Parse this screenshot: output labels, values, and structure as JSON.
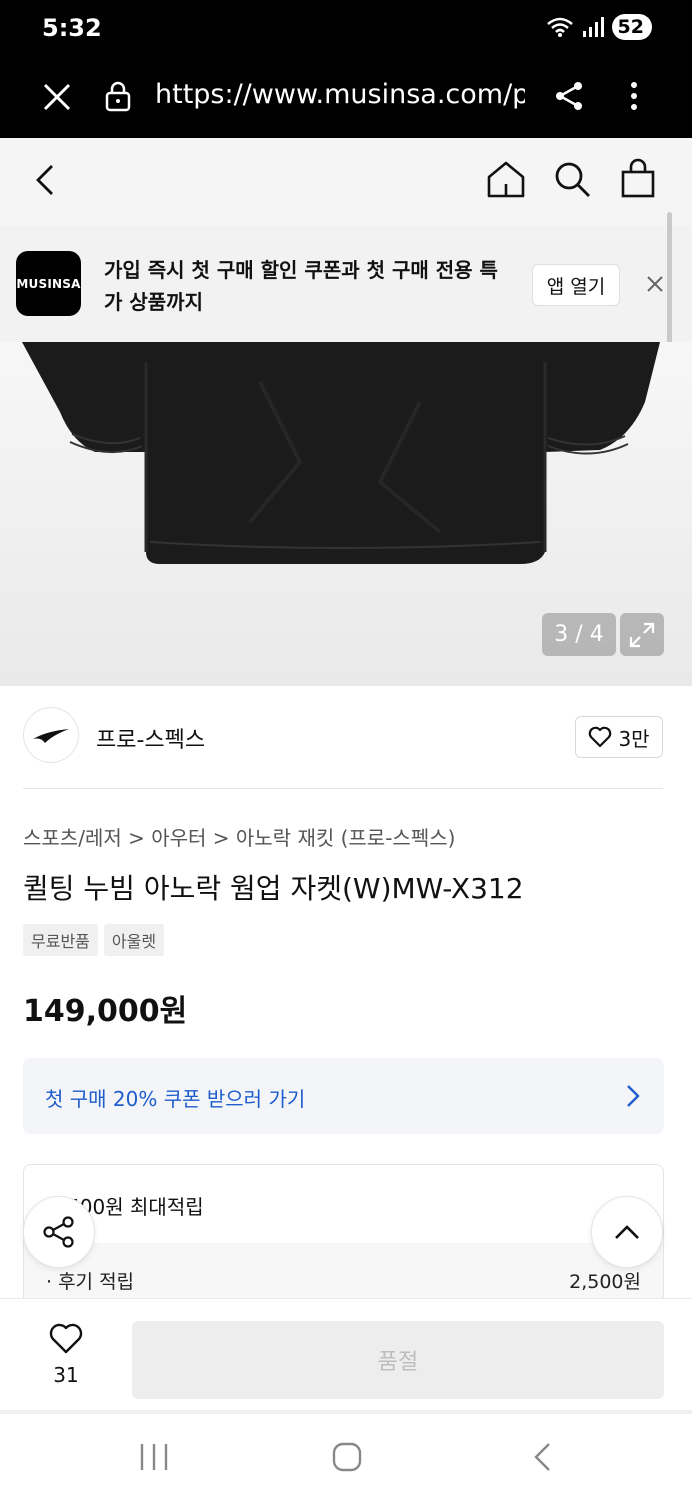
{
  "status": {
    "time": "5:32",
    "battery": "52"
  },
  "browser": {
    "url": "https://www.musinsa.com/pr"
  },
  "banner": {
    "logo": "MUSINSA",
    "text": "가입 즉시 첫 구매 할인 쿠폰과 첫 구매 전용 특가 상품까지",
    "open_app": "앱 열기"
  },
  "gallery": {
    "counter": "3 / 4"
  },
  "brand": {
    "name": "프로-스펙스",
    "likes": "3만"
  },
  "product": {
    "breadcrumb": "스포츠/레저 > 아우터 > 아노락 재킷 (프로-스펙스)",
    "title": "퀼팅 누빔 아노락 웜업 자켓(W)MW-X312",
    "tags": [
      "무료반품",
      "아울렛"
    ],
    "price": "149,000원"
  },
  "coupon": {
    "text": "첫 구매 20% 쿠폰 받으러 가기"
  },
  "points": {
    "title": "2,500원 최대적립",
    "row_label": "· 후기 적립",
    "row_value": "2,500원"
  },
  "bottom": {
    "wish_count": "31",
    "buy_label": "품절"
  },
  "icons": [
    "close-icon",
    "lock-icon",
    "share-icon",
    "more-icon",
    "back-icon",
    "home-icon",
    "search-icon",
    "bag-icon",
    "expand-icon",
    "heart-icon",
    "chevron-right-icon",
    "chevron-up-icon"
  ]
}
